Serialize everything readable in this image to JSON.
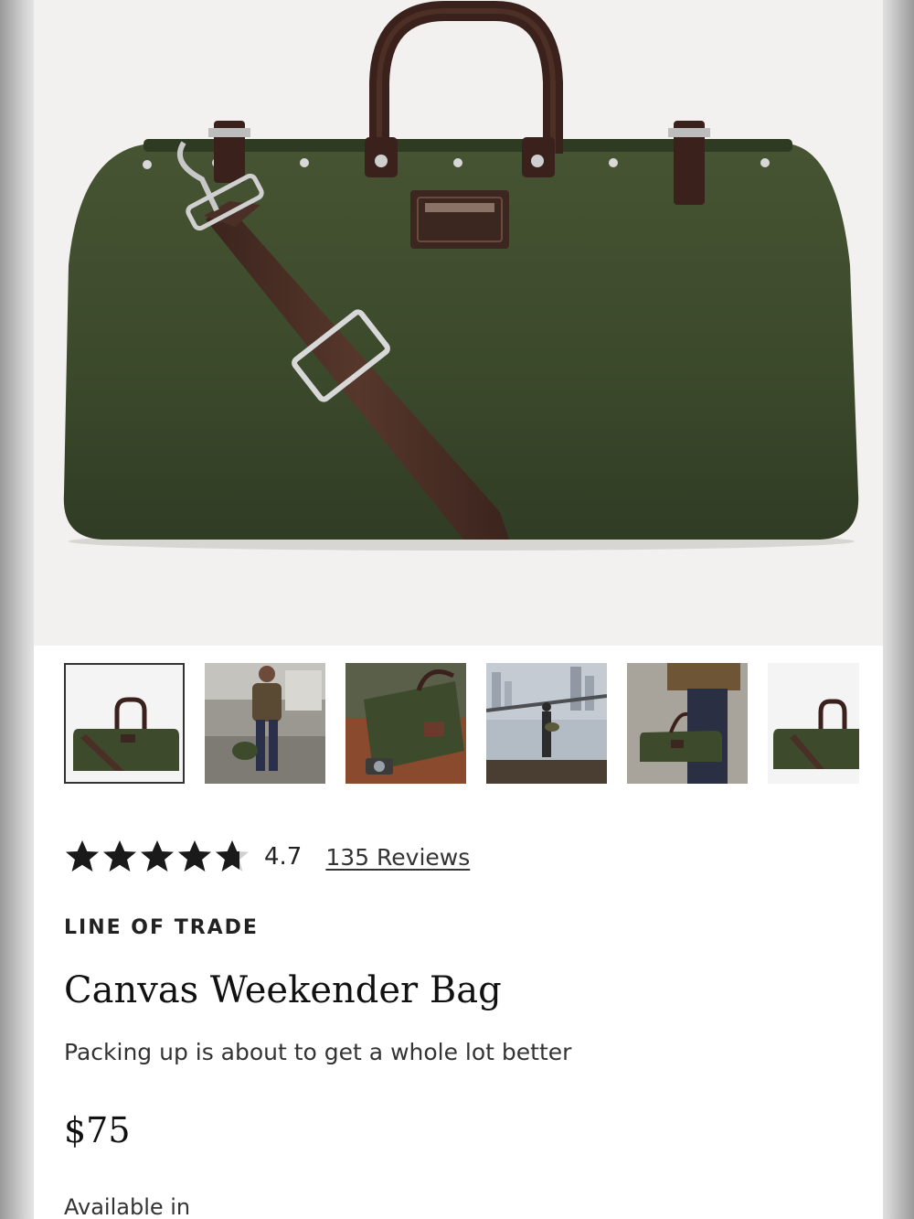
{
  "product": {
    "brand": "LINE OF TRADE",
    "title": "Canvas Weekender Bag",
    "tagline": "Packing up is about to get a whole lot better",
    "price": "$75",
    "availability_label": "Available in"
  },
  "rating": {
    "value": "4.7",
    "stars": 4.7,
    "reviews_label": "135 Reviews"
  },
  "gallery": {
    "selected_index": 0,
    "thumbnails": [
      {
        "name": "thumb-bag-front"
      },
      {
        "name": "thumb-man-walking"
      },
      {
        "name": "thumb-bag-open"
      },
      {
        "name": "thumb-bridge-view"
      },
      {
        "name": "thumb-bag-carried"
      },
      {
        "name": "thumb-bag-side"
      }
    ]
  },
  "colors": {
    "bag_green": "#3d4a2c",
    "leather_brown": "#3e2620",
    "strap_brown": "#4a2f26",
    "hardware_silver": "#c9c9c9",
    "star": "#1a1a1a"
  }
}
